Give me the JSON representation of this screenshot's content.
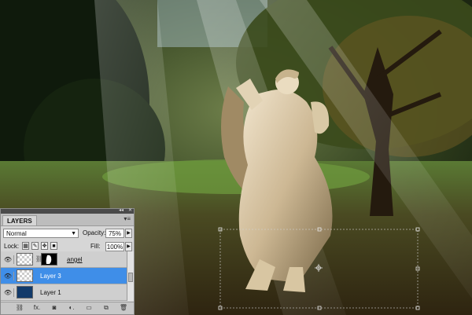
{
  "canvas": {
    "description_colors": {
      "forest_dark": "#10180c",
      "grass": "#4a6a2c",
      "sky": "#9fb7b8"
    }
  },
  "layers_panel": {
    "tab_label": "LAYERS",
    "collapse_label": "◂◂",
    "close_label": "✕",
    "menu_icon_label": "▾≡",
    "blend_mode": "Normal",
    "opacity_label": "Opacity:",
    "opacity_value": "75%",
    "lock_label": "Lock:",
    "fill_label": "Fill:",
    "fill_value": "100%",
    "layers": [
      {
        "name": "angel",
        "selected": false,
        "visible": true,
        "has_mask": true
      },
      {
        "name": "Layer 3",
        "selected": true,
        "visible": true,
        "has_mask": false
      },
      {
        "name": "Layer 1",
        "selected": false,
        "visible": true,
        "has_mask": false
      }
    ],
    "footer_icons": [
      "link-icon",
      "fx-icon",
      "mask-icon",
      "adjustment-icon",
      "folder-icon",
      "new-layer-icon",
      "trash-icon"
    ],
    "footer_labels": [
      "⛓",
      "fx.",
      "◙",
      "◐.",
      "▭",
      "⧉",
      "🗑"
    ]
  }
}
